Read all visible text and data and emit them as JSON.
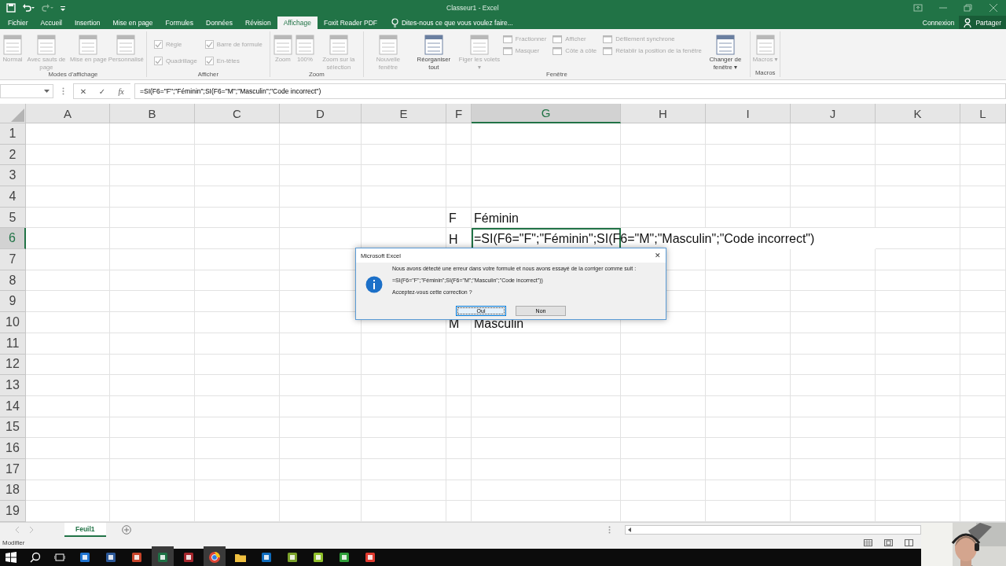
{
  "window": {
    "title": "Classeur1 - Excel"
  },
  "tabs": [
    {
      "label": "Fichier",
      "selected": false
    },
    {
      "label": "Accueil",
      "selected": false
    },
    {
      "label": "Insertion",
      "selected": false
    },
    {
      "label": "Mise en page",
      "selected": false
    },
    {
      "label": "Formules",
      "selected": false
    },
    {
      "label": "Données",
      "selected": false
    },
    {
      "label": "Révision",
      "selected": false
    },
    {
      "label": "Affichage",
      "selected": true
    },
    {
      "label": "Foxit Reader PDF",
      "selected": false
    }
  ],
  "tell_me": {
    "placeholder": "Dites-nous ce que vous voulez faire..."
  },
  "account": {
    "sign_in": "Connexion",
    "share": "Partager"
  },
  "ribbon": {
    "groups": [
      {
        "label": "Modes d'affichage",
        "items": [
          {
            "kind": "large",
            "label": "Normal",
            "disabled": true
          },
          {
            "kind": "large",
            "label": "Avec sauts de page",
            "disabled": true
          },
          {
            "kind": "large",
            "label": "Mise en page",
            "disabled": true
          },
          {
            "kind": "large",
            "label": "Personnalisé",
            "disabled": true
          }
        ]
      },
      {
        "label": "Afficher",
        "items": [
          {
            "kind": "check",
            "label": "Règle",
            "checked": true,
            "disabled": true
          },
          {
            "kind": "check",
            "label": "Quadrillage",
            "checked": true,
            "disabled": true
          },
          {
            "kind": "check",
            "label": "Barre de formule",
            "checked": true,
            "disabled": true
          },
          {
            "kind": "check",
            "label": "En-têtes",
            "checked": true,
            "disabled": true
          }
        ]
      },
      {
        "label": "Zoom",
        "items": [
          {
            "kind": "large",
            "label": "Zoom",
            "disabled": true
          },
          {
            "kind": "large",
            "label": "100%",
            "disabled": true
          },
          {
            "kind": "large",
            "label": "Zoom sur la sélection",
            "disabled": true
          }
        ]
      },
      {
        "label": "Fenêtre",
        "items": [
          {
            "kind": "large",
            "label": "Nouvelle fenêtre",
            "disabled": true
          },
          {
            "kind": "large",
            "label": "Réorganiser tout",
            "disabled": false
          },
          {
            "kind": "large",
            "label": "Figer les volets ▾",
            "disabled": true
          },
          {
            "kind": "small",
            "label": "Fractionner",
            "disabled": true
          },
          {
            "kind": "small",
            "label": "Masquer",
            "disabled": true
          },
          {
            "kind": "small",
            "label": "Afficher",
            "disabled": true
          },
          {
            "kind": "small",
            "label": "Côte à côte",
            "disabled": true
          },
          {
            "kind": "small",
            "label": "Défilement synchrone",
            "disabled": true
          },
          {
            "kind": "small",
            "label": "Rétablir la position de la fenêtre",
            "disabled": true
          },
          {
            "kind": "large",
            "label": "Changer de fenêtre ▾",
            "disabled": false
          }
        ]
      },
      {
        "label": "Macros",
        "items": [
          {
            "kind": "large",
            "label": "Macros ▾",
            "disabled": true
          }
        ]
      }
    ]
  },
  "formula_bar": {
    "cancel": "✕",
    "enter": "✓",
    "function": "fx",
    "value": "=SI(F6=\"F\";\"Féminin\";SI(F6=\"M\";\"Masculin\";\"Code incorrect\")"
  },
  "columns": [
    {
      "label": "A",
      "selected": false
    },
    {
      "label": "B",
      "selected": false
    },
    {
      "label": "C",
      "selected": false
    },
    {
      "label": "D",
      "selected": false
    },
    {
      "label": "E",
      "selected": false
    },
    {
      "label": "F",
      "selected": false
    },
    {
      "label": "G",
      "selected": true
    },
    {
      "label": "H",
      "selected": false
    },
    {
      "label": "I",
      "selected": false
    },
    {
      "label": "J",
      "selected": false
    },
    {
      "label": "K",
      "selected": false
    },
    {
      "label": "L",
      "selected": false
    }
  ],
  "rows": [
    {
      "label": "1",
      "selected": false
    },
    {
      "label": "2",
      "selected": false
    },
    {
      "label": "3",
      "selected": false
    },
    {
      "label": "4",
      "selected": false
    },
    {
      "label": "5",
      "selected": false,
      "column_f": "F",
      "column_g": "Féminin"
    },
    {
      "label": "6",
      "selected": true,
      "column_f": "H",
      "column_g": "=SI(F6=\"F\";\"Féminin\";SI(F6=\"M\";\"Masculin\";\"Code incorrect\")"
    },
    {
      "label": "7",
      "selected": false
    },
    {
      "label": "8",
      "selected": false
    },
    {
      "label": "9",
      "selected": false
    },
    {
      "label": "10",
      "selected": false,
      "column_f": "M",
      "column_g": "Masculin"
    },
    {
      "label": "11",
      "selected": false
    },
    {
      "label": "12",
      "selected": false
    },
    {
      "label": "13",
      "selected": false
    },
    {
      "label": "14",
      "selected": false
    },
    {
      "label": "15",
      "selected": false
    },
    {
      "label": "16",
      "selected": false
    },
    {
      "label": "17",
      "selected": false
    },
    {
      "label": "18",
      "selected": false
    },
    {
      "label": "19",
      "selected": false
    }
  ],
  "sheets": [
    {
      "label": "Feuil1",
      "selected": true
    }
  ],
  "status_bar": {
    "mode": "Modifier"
  },
  "dialog": {
    "title": "Microsoft Excel",
    "close": "✕",
    "message": "Nous avons détecté une erreur dans votre formule et nous avons essayé de la corriger comme suit :",
    "formula": "=SI(F6=\"F\";\"Féminin\";SI(F6=\"M\";\"Masculin\";\"Code incorrect\"))",
    "question": "Acceptez-vous cette correction ?",
    "buttons": [
      {
        "label": "Oui",
        "selected": true
      },
      {
        "label": "Non",
        "selected": false
      }
    ]
  }
}
